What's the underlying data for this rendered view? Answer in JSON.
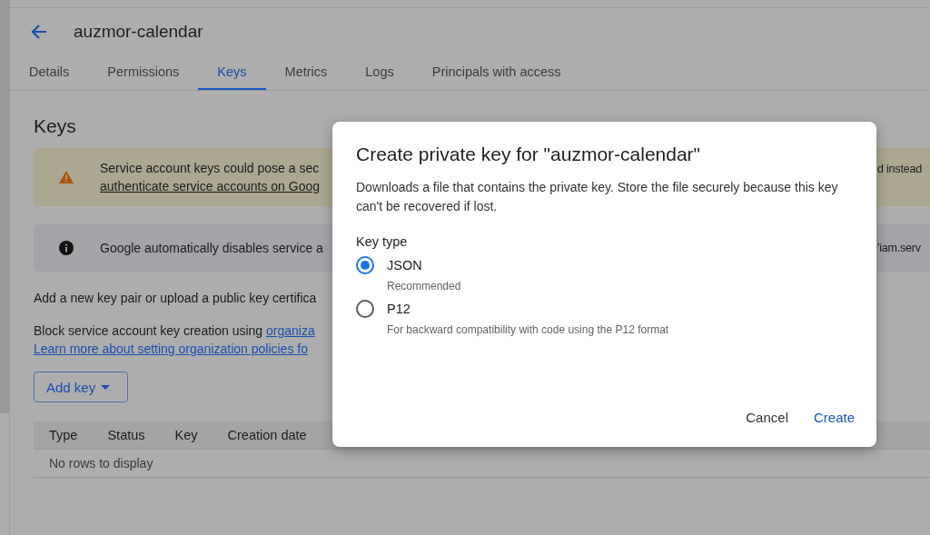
{
  "header": {
    "title": "auzmor-calendar"
  },
  "tabs": [
    {
      "label": "Details",
      "selected": false
    },
    {
      "label": "Permissions",
      "selected": false
    },
    {
      "label": "Keys",
      "selected": true
    },
    {
      "label": "Metrics",
      "selected": false
    },
    {
      "label": "Logs",
      "selected": false
    },
    {
      "label": "Principals with access",
      "selected": false
    }
  ],
  "page_title": "Keys",
  "warning_banner": {
    "text": "Service account keys could pose a sec",
    "link": "authenticate service accounts on Goog",
    "text_right": "d instead"
  },
  "info_banner": {
    "text": "Google automatically disables service a",
    "text_right": "'iam.serv"
  },
  "description": "Add a new key pair or upload a public key certifica",
  "policy": {
    "text": "Block service account key creation using",
    "link": "organiza"
  },
  "learn_more_link": "Learn more about setting organization policies fo",
  "add_key_button": "Add key",
  "table": {
    "columns": [
      "Type",
      "Status",
      "Key",
      "Creation date"
    ],
    "empty_message": "No rows to display"
  },
  "dialog": {
    "title": "Create private key for \"auzmor-calendar\"",
    "description": "Downloads a file that contains the private key. Store the file securely because this key can't be recovered if lost.",
    "key_type_label": "Key type",
    "options": [
      {
        "label": "JSON",
        "hint": "Recommended",
        "selected": true
      },
      {
        "label": "P12",
        "hint": "For backward compatibility with code using the P12 format",
        "selected": false
      }
    ],
    "buttons": [
      {
        "label": "Cancel",
        "kind": "secondary"
      },
      {
        "label": "Create",
        "kind": "primary"
      }
    ]
  }
}
